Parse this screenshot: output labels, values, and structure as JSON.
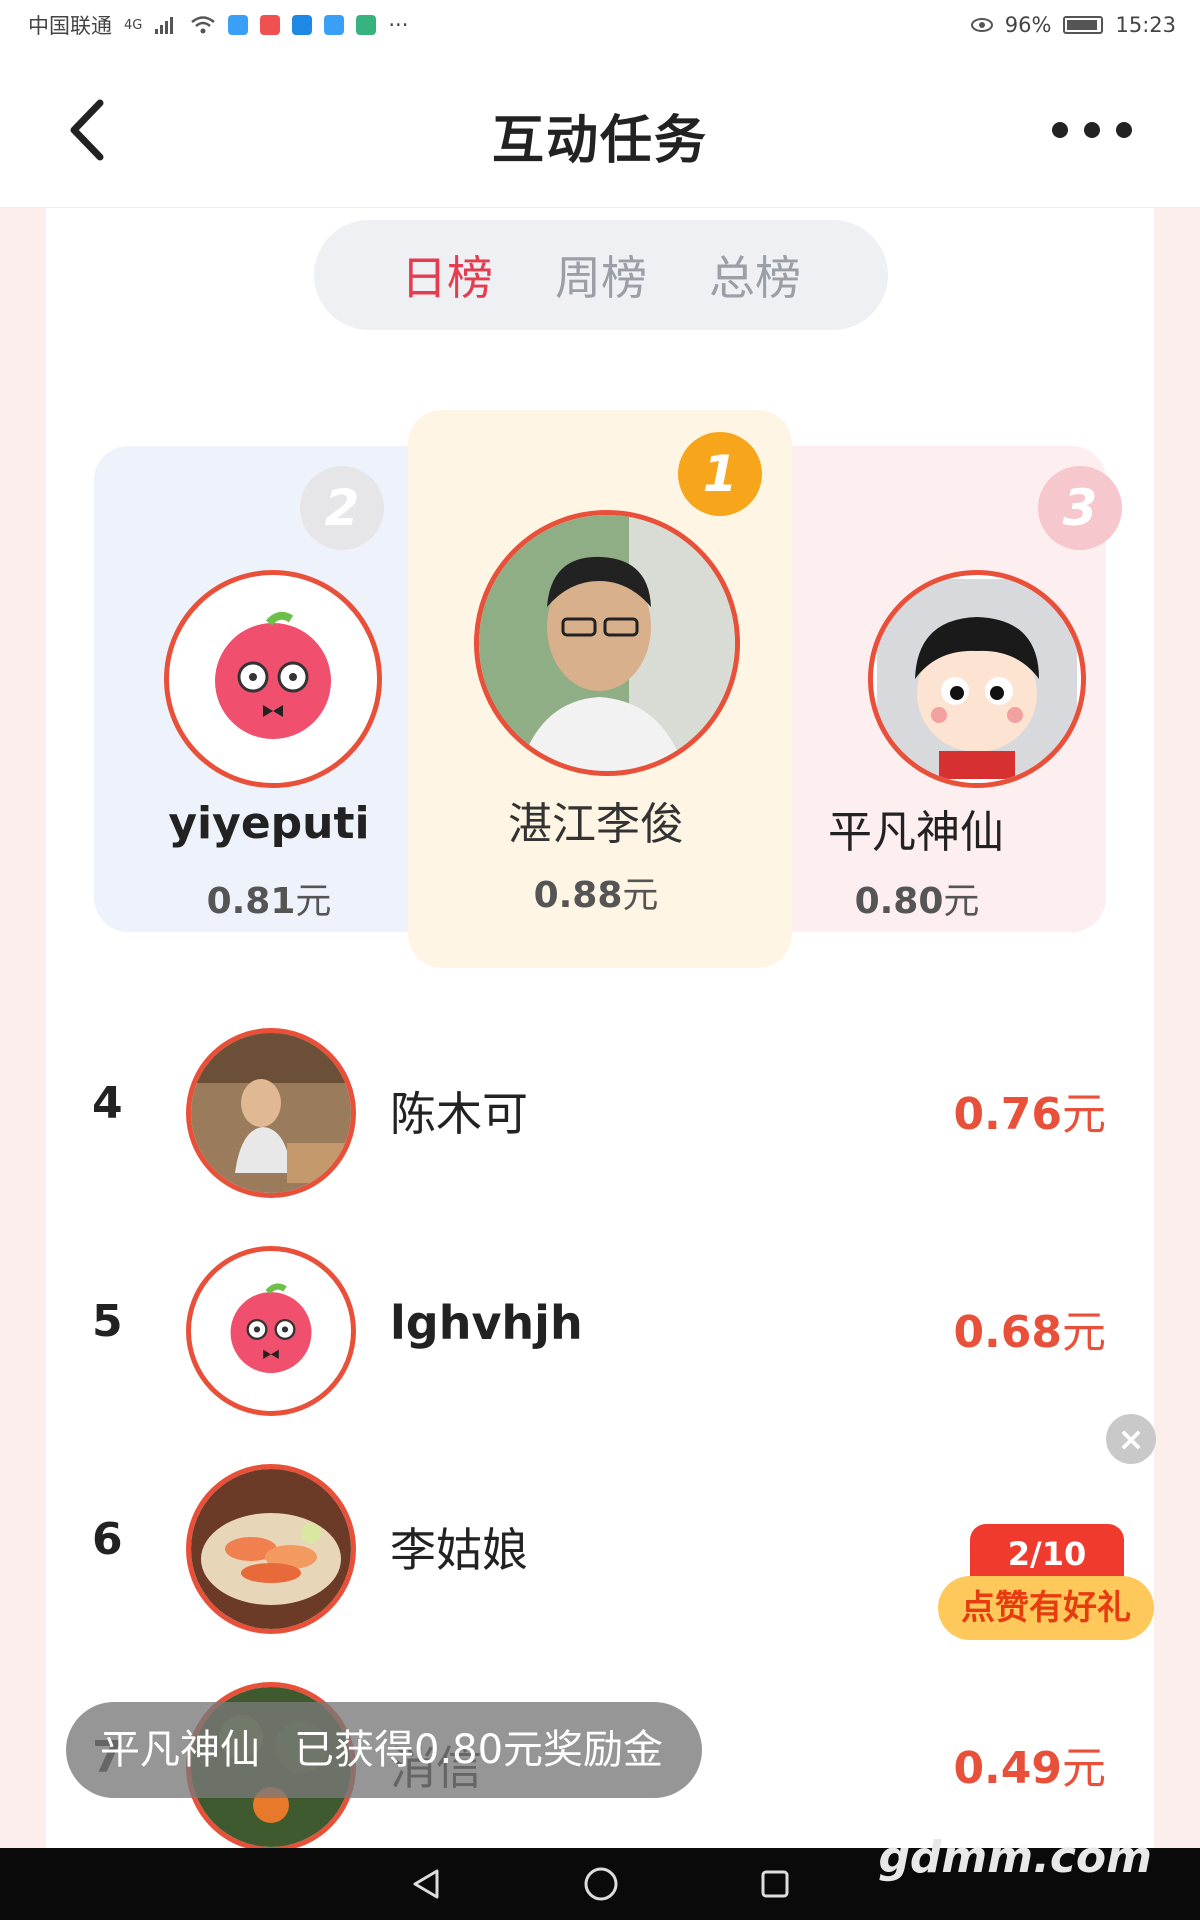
{
  "status_bar": {
    "carrier": "中国联通",
    "network": "4G",
    "battery_percent": "96%",
    "time": "15:23"
  },
  "nav": {
    "title": "互动任务",
    "back_icon": "chevron-left-icon",
    "more_icon": "more-horizontal-icon"
  },
  "tabs": [
    {
      "label": "日榜",
      "active": true
    },
    {
      "label": "周榜",
      "active": false
    },
    {
      "label": "总榜",
      "active": false
    }
  ],
  "podium": {
    "first": {
      "rank": "1",
      "name": "湛江李俊",
      "amount": "0.88",
      "unit": "元"
    },
    "second": {
      "rank": "2",
      "name": "yiyeputi",
      "amount": "0.81",
      "unit": "元"
    },
    "third": {
      "rank": "3",
      "name": "平凡神仙",
      "amount": "0.80",
      "unit": "元"
    }
  },
  "list": [
    {
      "rank": "4",
      "name": "陈木可",
      "amount": "0.76",
      "unit": "元"
    },
    {
      "rank": "5",
      "name": "lghvhjh",
      "amount": "0.68",
      "unit": "元"
    },
    {
      "rank": "6",
      "name": "李姑娘",
      "amount": "",
      "unit": ""
    },
    {
      "rank": "7",
      "name": "消信",
      "amount": "0.49",
      "unit": "元"
    }
  ],
  "promo": {
    "progress": "2/10",
    "label": "点赞有好礼"
  },
  "toast": {
    "user": "平凡神仙",
    "message": "已获得0.80元奖励金"
  },
  "watermark": "gdmm.com",
  "colors": {
    "accent": "#e63c50",
    "amount": "#e8503a",
    "first_place_bg": "#fff5e4",
    "second_place_bg": "#eef3fb",
    "third_place_bg": "#fdeef0"
  }
}
